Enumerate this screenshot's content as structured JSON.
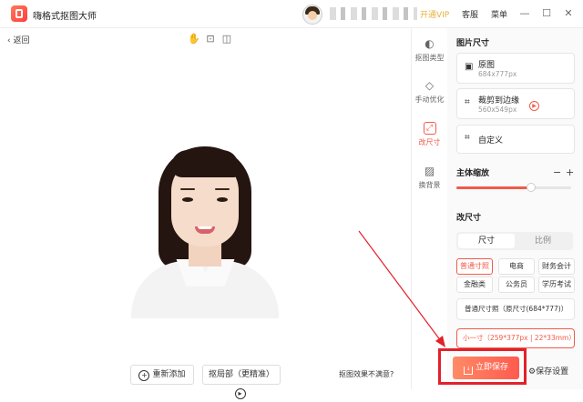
{
  "app": {
    "title": "嗨格式抠图大师"
  },
  "titlebar": {
    "vip": "开通VIP",
    "service": "客服",
    "menu": "菜单",
    "minimize": "—",
    "maximize": "☐",
    "close": "✕"
  },
  "toolbar": {
    "back": "返回"
  },
  "bottom": {
    "re_add": "重新添加",
    "partial": "抠局部（更精准）",
    "hint": "抠图效果不满意?"
  },
  "vtabs": [
    {
      "label": "抠图类型",
      "icon": "◐"
    },
    {
      "label": "手动优化",
      "icon": "◇"
    },
    {
      "label": "改尺寸",
      "icon": "⤢"
    },
    {
      "label": "换背景",
      "icon": "▨"
    }
  ],
  "panel": {
    "image_size_title": "图片尺寸",
    "original": {
      "label": "原图",
      "size": "684x777px"
    },
    "crop": {
      "label": "裁剪到边缘",
      "size": "560x549px"
    },
    "custom": {
      "label": "自定义"
    },
    "zoom_title": "主体缩放",
    "zoom_minus": "−",
    "zoom_plus": "+",
    "zoom_level": 0.65,
    "resize_title": "改尺寸",
    "seg": {
      "size": "尺寸",
      "ratio": "比例"
    },
    "chips": [
      "普通寸照",
      "电商",
      "财务会计",
      "金融类",
      "公务员",
      "学历考试"
    ],
    "standard": "普通尺寸照（原尺寸(684*777)）",
    "small": "小一寸（259*377px | 22*33mm）"
  },
  "actions": {
    "save_now": "立即保存",
    "save_settings": "保存设置"
  },
  "colors": {
    "accent": "#f25a4a",
    "highlight_border": "#e3212b",
    "vip": "#e8b13c"
  }
}
